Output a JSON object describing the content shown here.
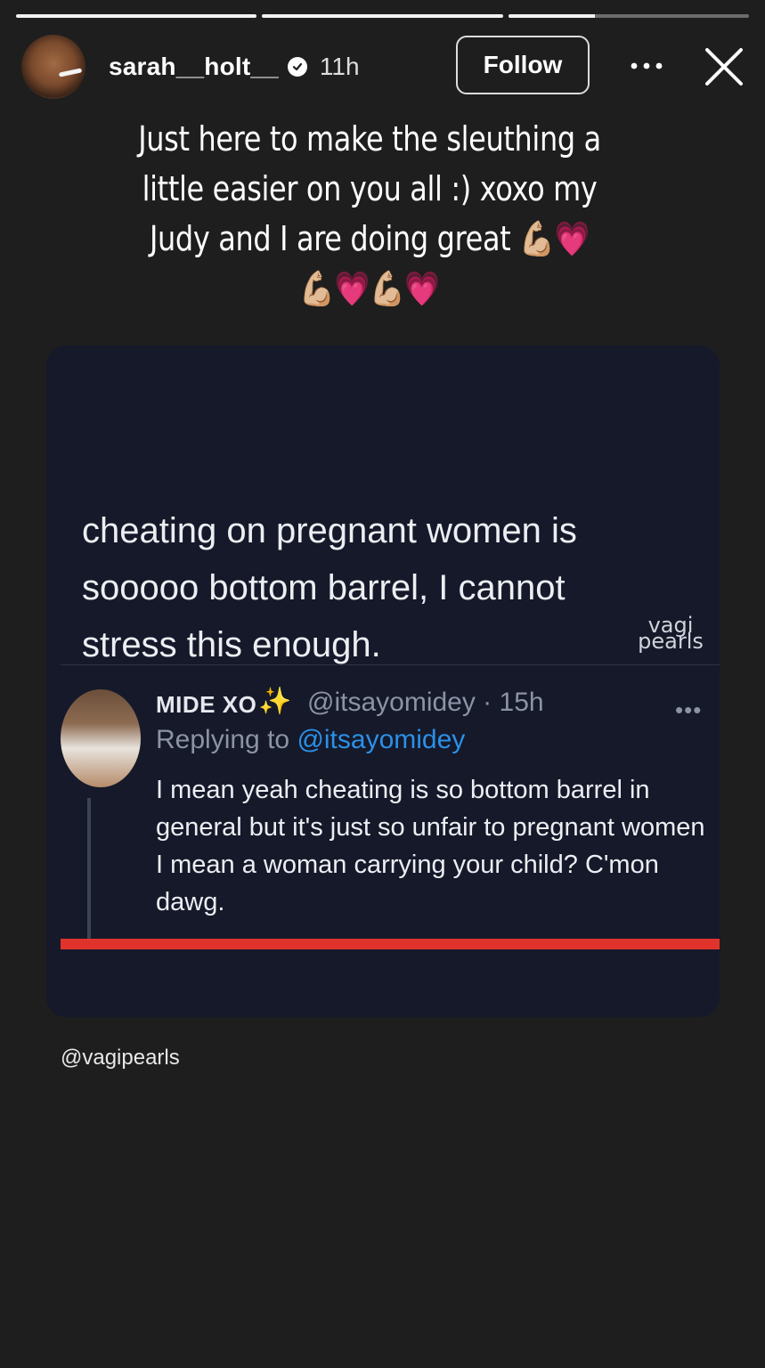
{
  "story": {
    "progress": [
      1.0,
      1.0,
      0.36
    ]
  },
  "header": {
    "username": "sarah__holt__",
    "time": "11h",
    "follow_label": "Follow",
    "more_icon": "ellipsis-icon",
    "close_icon": "close-icon",
    "verified_icon": "verified-badge-icon"
  },
  "caption": {
    "line1": "Just here to make the sleuthing a",
    "line2": "little easier on you all :) xoxo my",
    "line3": "Judy and I are doing great 💪🏼💗",
    "line4": "💪🏼💗💪🏼💗"
  },
  "tweet": {
    "text": "cheating on pregnant women is sooooo bottom barrel, I cannot stress this enough.",
    "watermark_line1": "vagi",
    "watermark_line2": "pearls",
    "reply": {
      "name": "MIDE XO",
      "sparkle": "✨",
      "handle": "@itsayomidey · 15h",
      "more": "•••",
      "replying_prefix": "Replying to",
      "replying_mention": "@itsayomidey",
      "text": "I mean yeah cheating is so bottom barrel in general   but it's just so unfair to pregnant women I mean a woman carrying your child? C'mon dawg."
    }
  },
  "credit": "@vagipearls",
  "colors": {
    "background": "#1e1e1e",
    "card": "#15192a",
    "mention": "#2b90e6",
    "red_bar": "#e0332b"
  }
}
